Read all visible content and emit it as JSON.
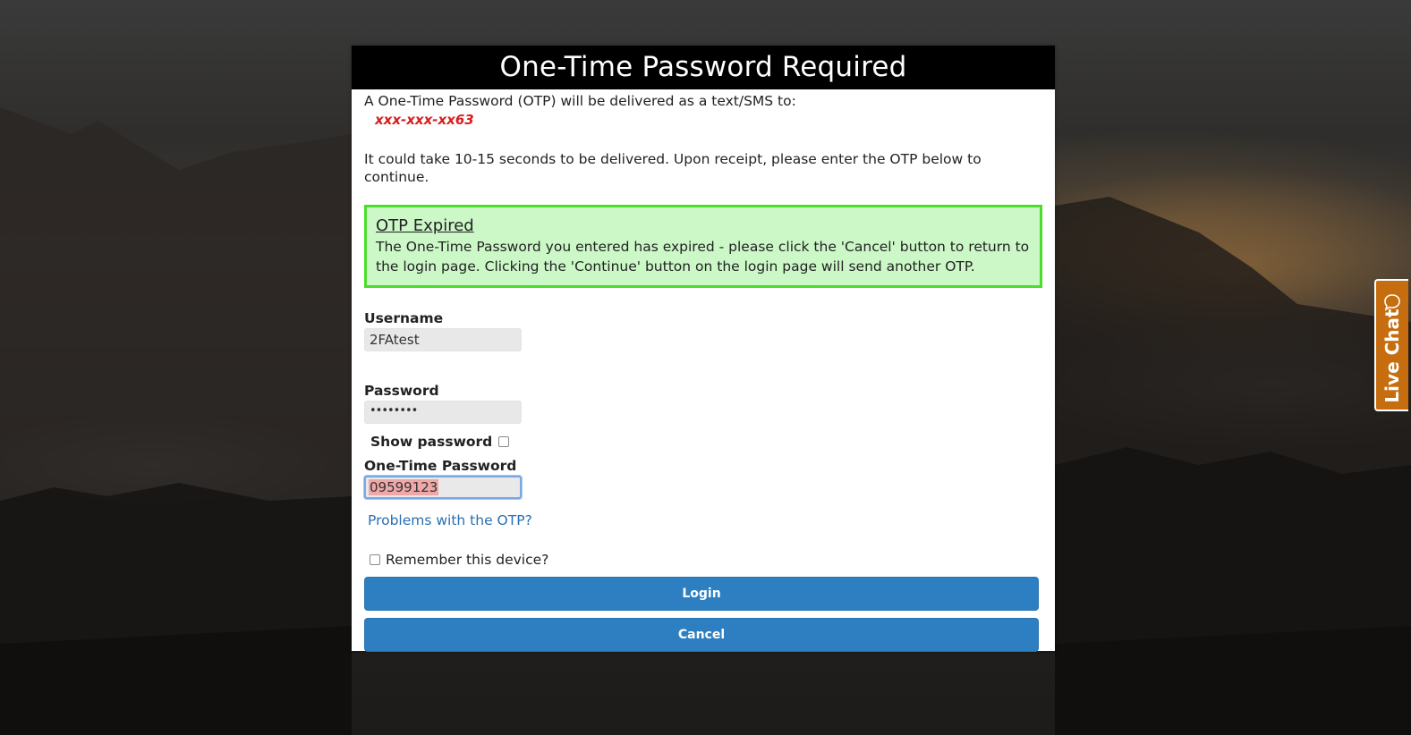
{
  "modal": {
    "title": "One-Time Password Required",
    "intro": "A One-Time Password (OTP) will be delivered as a text/SMS to:",
    "phone": "xxx-xxx-xx63",
    "wait_text": "It could take 10-15 seconds to be delivered. Upon receipt, please enter the OTP below to continue."
  },
  "alert": {
    "title": "OTP Expired",
    "text": "The One-Time Password you entered has expired - please click the 'Cancel' button to return to the login page. Clicking the 'Continue' button on the login page will send another OTP.",
    "border_color": "#4cdd2c",
    "background_color": "#ccf8c8"
  },
  "form": {
    "username_label": "Username",
    "username_value": "2FAtest",
    "password_label": "Password",
    "password_value": "••••••••",
    "show_password_label": "Show password",
    "show_password_checked": false,
    "otp_label": "One-Time Password",
    "otp_value": "09599123",
    "otp_help_link": "Problems with the OTP?",
    "remember_label": "Remember this device?",
    "remember_checked": false,
    "login_button": "Login",
    "cancel_button": "Cancel"
  },
  "live_chat": {
    "label": "Live Chat",
    "icon": "chat-bubble-icon",
    "color": "#c66d10"
  },
  "colors": {
    "header_bg": "#000000",
    "button_bg": "#2d7fc1",
    "phone_text": "#d81d1d",
    "link": "#2a6fb0"
  }
}
